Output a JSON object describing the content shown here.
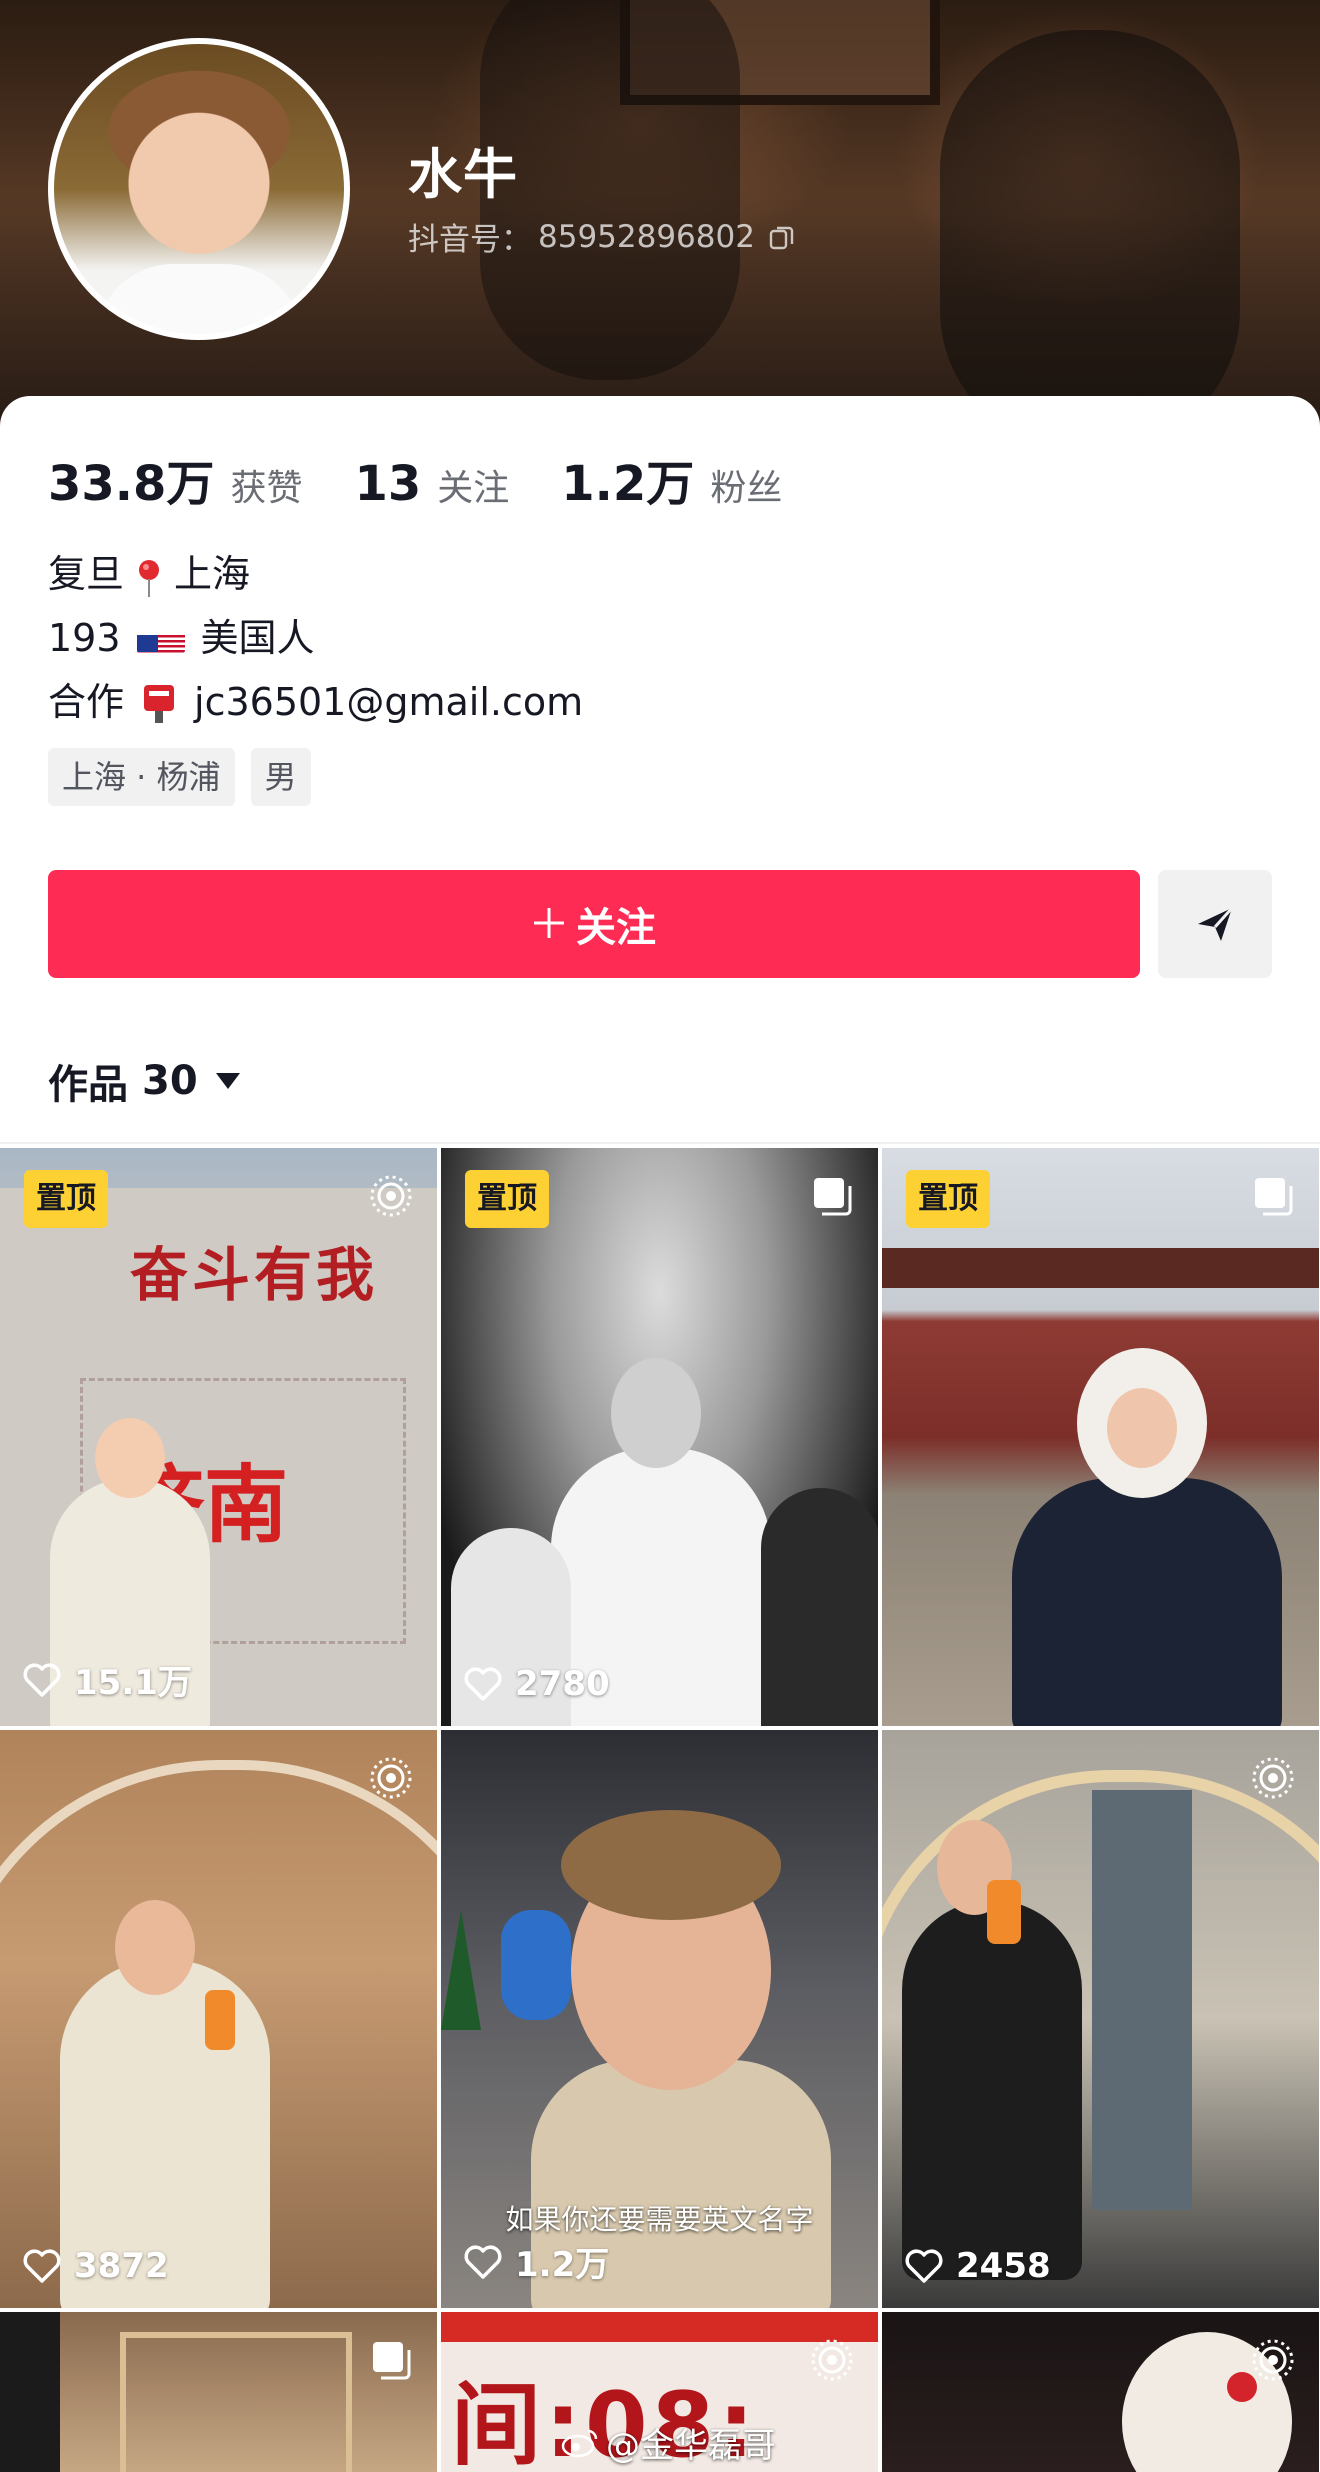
{
  "profile": {
    "name": "水牛",
    "douyin_id_label": "抖音号：",
    "douyin_id": "85952896802"
  },
  "stats": [
    {
      "value": "33.8万",
      "label": "获赞"
    },
    {
      "value": "13",
      "label": "关注"
    },
    {
      "value": "1.2万",
      "label": "粉丝"
    }
  ],
  "bio": {
    "line1_a": "复旦",
    "line1_b": "上海",
    "line2_a": "193",
    "line2_b": "美国人",
    "line3_a": "合作",
    "line3_b": "jc36501@gmail.com"
  },
  "tags": [
    "上海 · 杨浦",
    "男"
  ],
  "follow_button": "+ 关注",
  "follow_label": "关注",
  "works": {
    "label": "作品",
    "count": "30"
  },
  "videos": [
    {
      "pinned": "置顶",
      "likes": "15.1万",
      "corner_icon": "live-photo-icon"
    },
    {
      "pinned": "置顶",
      "likes": "2780",
      "corner_icon": "multi-image-icon"
    },
    {
      "pinned": "置顶",
      "likes": "",
      "corner_icon": "multi-image-icon"
    },
    {
      "pinned": "",
      "likes": "3872",
      "corner_icon": "live-photo-icon"
    },
    {
      "pinned": "",
      "likes": "1.2万",
      "caption": "如果你还要需要英文名字",
      "corner_icon": ""
    },
    {
      "pinned": "",
      "likes": "2458",
      "corner_icon": "live-photo-icon"
    },
    {
      "pinned": "",
      "likes": "",
      "corner_icon": "multi-image-icon"
    },
    {
      "pinned": "",
      "likes": "",
      "corner_icon": "live-photo-icon"
    },
    {
      "pinned": "",
      "likes": "",
      "corner_icon": "live-photo-icon"
    }
  ],
  "watermark": "@金华磊哥",
  "colors": {
    "accent": "#fe2c55",
    "pin_badge": "#fdd133",
    "text": "#161823",
    "muted": "#6b6d75"
  }
}
